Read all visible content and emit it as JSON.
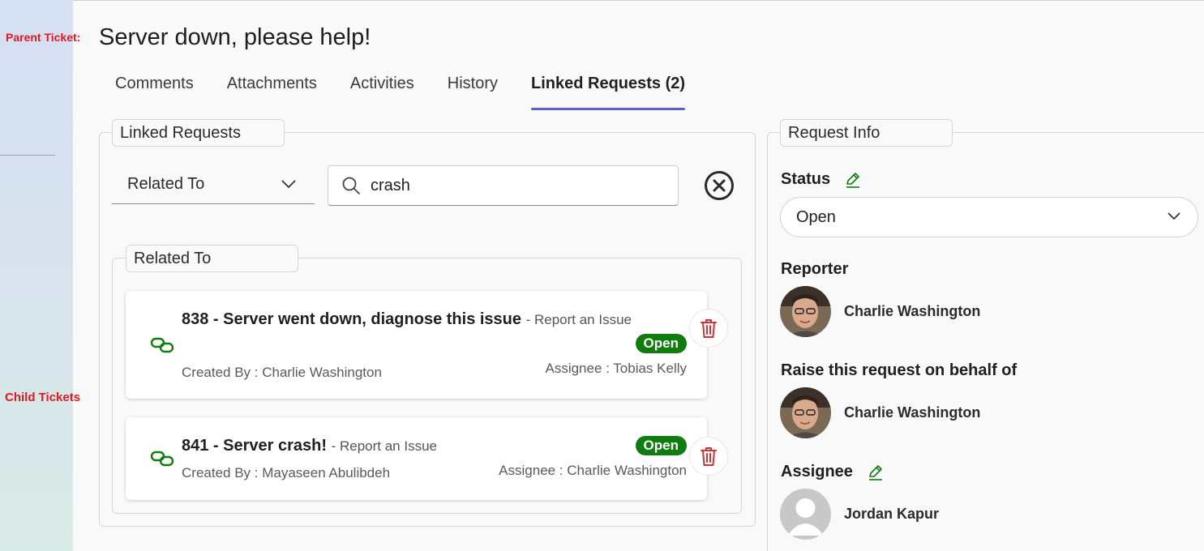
{
  "annotations": {
    "parent": "Parent Ticket:",
    "child": "Child Tickets"
  },
  "page": {
    "title": "Server down, please help!"
  },
  "tabs": [
    {
      "label": "Comments"
    },
    {
      "label": "Attachments"
    },
    {
      "label": "Activities"
    },
    {
      "label": "History"
    },
    {
      "label": "Linked Requests (2)",
      "active": true
    }
  ],
  "linked_panel": {
    "legend": "Linked Requests",
    "filter": {
      "selected": "Related To"
    },
    "search": {
      "value": "crash"
    },
    "group": {
      "legend": "Related To",
      "items": [
        {
          "title": "838 - Server went down, diagnose this issue",
          "type": "- Report an Issue",
          "status": "Open",
          "created_by": "Created By : Charlie Washington",
          "assignee": "Assignee : Tobias Kelly"
        },
        {
          "title": "841 - Server crash!",
          "type": "- Report an Issue",
          "status": "Open",
          "created_by": "Created By : Mayaseen Abulibdeh",
          "assignee": "Assignee : Charlie Washington"
        }
      ]
    }
  },
  "info_panel": {
    "legend": "Request Info",
    "status_label": "Status",
    "status_value": "Open",
    "reporter_label": "Reporter",
    "reporter_name": "Charlie Washington",
    "behalf_label": "Raise this request on behalf of",
    "behalf_name": "Charlie Washington",
    "assignee_label": "Assignee",
    "assignee_name": "Jordan Kapur"
  },
  "colors": {
    "accent": "#5b5fc7",
    "status_open": "#107c10",
    "delete": "#d13438",
    "link": "#107c10",
    "annotation": "#e0191f"
  },
  "icons": [
    "chevron-down-icon",
    "search-icon",
    "clear-circle-icon",
    "link-icon",
    "trash-icon",
    "pencil-icon",
    "avatar-placeholder-icon"
  ]
}
